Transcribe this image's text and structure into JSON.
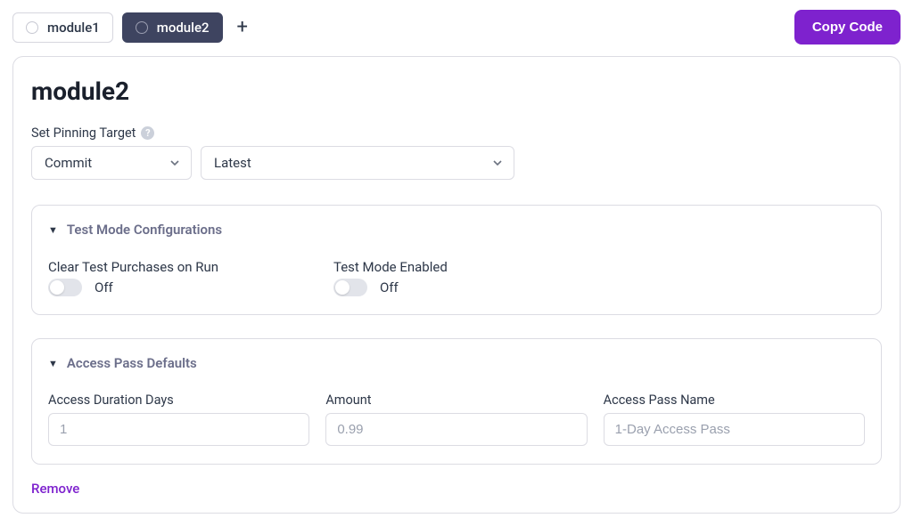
{
  "tabs": {
    "items": [
      {
        "label": "module1",
        "active": false
      },
      {
        "label": "module2",
        "active": true
      }
    ]
  },
  "header": {
    "copy_label": "Copy Code"
  },
  "module": {
    "title": "module2",
    "pinning": {
      "label": "Set Pinning Target",
      "type_value": "Commit",
      "version_value": "Latest"
    }
  },
  "test_mode": {
    "section_title": "Test Mode Configurations",
    "clear": {
      "label": "Clear Test Purchases on Run",
      "state_text": "Off"
    },
    "enabled": {
      "label": "Test Mode Enabled",
      "state_text": "Off"
    }
  },
  "access_defaults": {
    "section_title": "Access Pass Defaults",
    "duration": {
      "label": "Access Duration Days",
      "placeholder": "1"
    },
    "amount": {
      "label": "Amount",
      "placeholder": "0.99"
    },
    "name": {
      "label": "Access Pass Name",
      "placeholder": "1-Day Access Pass"
    }
  },
  "actions": {
    "remove_label": "Remove"
  }
}
